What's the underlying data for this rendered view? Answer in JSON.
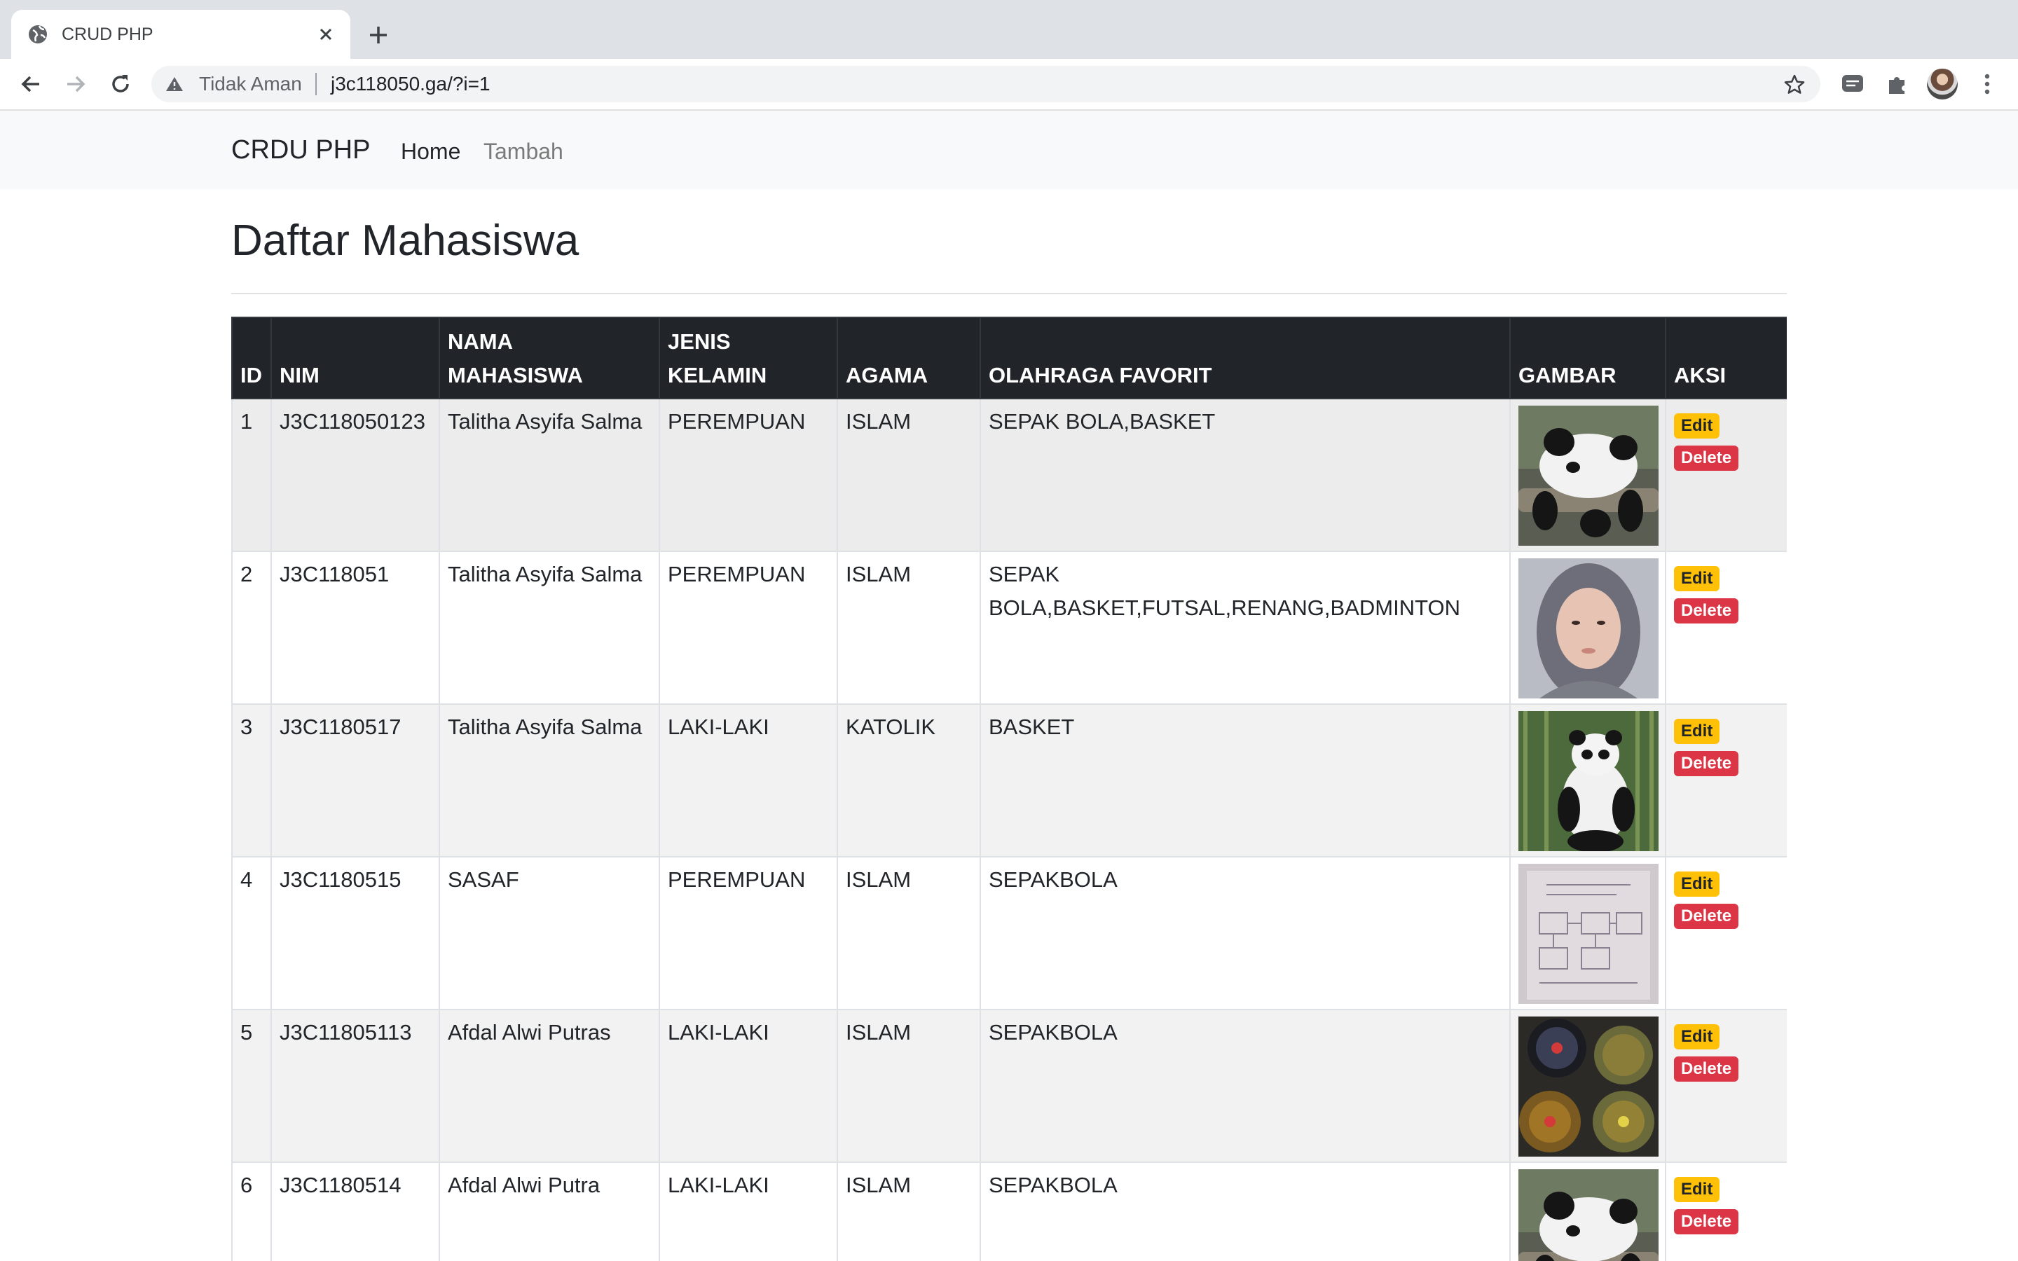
{
  "browser": {
    "tab_title": "CRUD PHP",
    "security_label": "Tidak Aman",
    "url": "j3c118050.ga/?i=1"
  },
  "navbar": {
    "brand": "CRDU PHP",
    "links": [
      "Home",
      "Tambah"
    ]
  },
  "page": {
    "heading": "Daftar Mahasiswa"
  },
  "table": {
    "headers": [
      "ID",
      "NIM",
      "NAMA MAHASISWA",
      "JENIS KELAMIN",
      "AGAMA",
      "OLAHRAGA FAVORIT",
      "GAMBAR",
      "AKSI"
    ],
    "rows": [
      {
        "id": "1",
        "nim": "J3C118050123",
        "nama": "Talitha Asyifa Salma",
        "jk": "PEREMPUAN",
        "agama": "ISLAM",
        "olahraga": "SEPAK BOLA,BASKET",
        "gambar": "panda-on-log"
      },
      {
        "id": "2",
        "nim": "J3C118051",
        "nama": "Talitha Asyifa Salma",
        "jk": "PEREMPUAN",
        "agama": "ISLAM",
        "olahraga": "SEPAK BOLA,BASKET,FUTSAL,RENANG,BADMINTON",
        "gambar": "portrait-hijab"
      },
      {
        "id": "3",
        "nim": "J3C1180517",
        "nama": "Talitha Asyifa Salma",
        "jk": "LAKI-LAKI",
        "agama": "KATOLIK",
        "olahraga": "BASKET",
        "gambar": "panda-bamboo"
      },
      {
        "id": "4",
        "nim": "J3C1180515",
        "nama": "SASAF",
        "jk": "PEREMPUAN",
        "agama": "ISLAM",
        "olahraga": "SEPAKBOLA",
        "gambar": "paper-sketch"
      },
      {
        "id": "5",
        "nim": "J3C11805113",
        "nama": "Afdal Alwi Putras",
        "jk": "LAKI-LAKI",
        "agama": "ISLAM",
        "olahraga": "SEPAKBOLA",
        "gambar": "food-jars"
      },
      {
        "id": "6",
        "nim": "J3C1180514",
        "nama": "Afdal Alwi Putra",
        "jk": "LAKI-LAKI",
        "agama": "ISLAM",
        "olahraga": "SEPAKBOLA",
        "gambar": "panda-on-log"
      }
    ],
    "edit_label": "Edit",
    "delete_label": "Delete"
  },
  "colors": {
    "navbar_bg": "#f8f9fa",
    "table_head_bg": "#212529",
    "edit_badge": "#ffc107",
    "delete_badge": "#dc3545"
  }
}
